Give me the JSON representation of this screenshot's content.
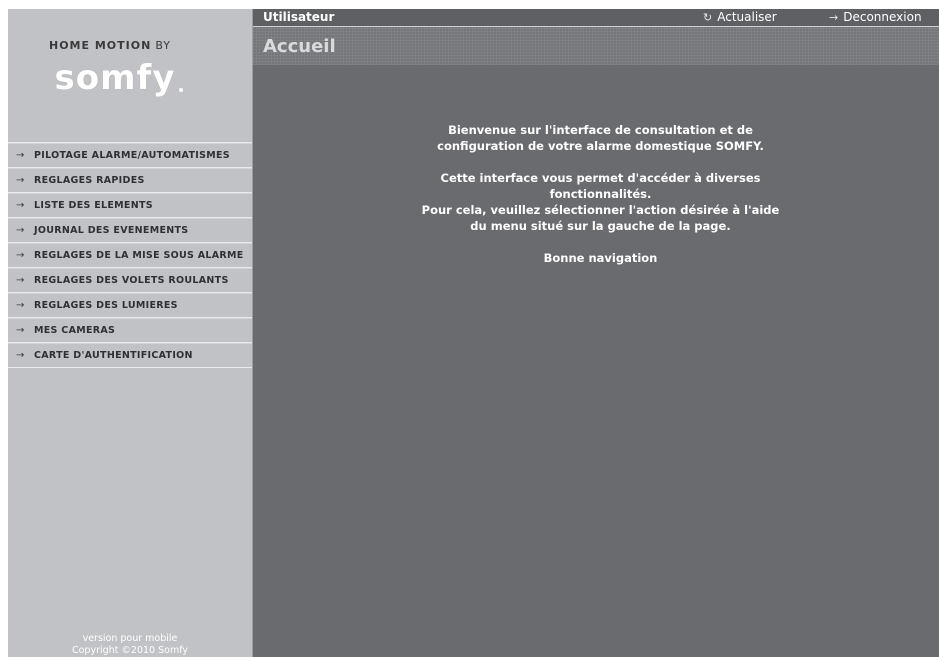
{
  "brand": {
    "tagline": "HOME MOTION",
    "by": "BY",
    "logo": "somfy"
  },
  "menu": {
    "items": [
      {
        "label": "PILOTAGE ALARME/AUTOMATISMES",
        "icon": "arrow-right-icon"
      },
      {
        "label": "REGLAGES RAPIDES",
        "icon": "arrow-right-icon"
      },
      {
        "label": "LISTE DES ELEMENTS",
        "icon": "arrow-right-icon"
      },
      {
        "label": "JOURNAL DES EVENEMENTS",
        "icon": "arrow-right-icon"
      },
      {
        "label": "REGLAGES DE LA MISE SOUS ALARME",
        "icon": "arrow-right-icon"
      },
      {
        "label": "REGLAGES DES VOLETS ROULANTS",
        "icon": "arrow-right-icon"
      },
      {
        "label": "REGLAGES DES LUMIERES",
        "icon": "arrow-right-icon"
      },
      {
        "label": "MES CAMERAS",
        "icon": "arrow-right-icon"
      },
      {
        "label": "CARTE D'AUTHENTIFICATION",
        "icon": "arrow-right-icon"
      }
    ]
  },
  "footer": {
    "mobile_link": "version pour mobile",
    "copyright": "Copyright ©2010 Somfy"
  },
  "topbar": {
    "user_label": "Utilisateur",
    "refresh_label": "Actualiser",
    "logout_label": "Deconnexion"
  },
  "page": {
    "title": "Accueil"
  },
  "welcome": {
    "line1": "Bienvenue sur l'interface de consultation et de configuration de votre alarme domestique SOMFY.",
    "line2": "Cette interface vous permet d'accéder à diverses fonctionnalités.",
    "line3": "Pour cela, veuillez sélectionner l'action désirée à l'aide du menu situé sur la gauche de la page.",
    "line4": "Bonne navigation"
  },
  "colors": {
    "sidebar_bg": "#c1c2c5",
    "main_bg": "#6a6b6f",
    "topbar_bg": "#5f6064"
  }
}
